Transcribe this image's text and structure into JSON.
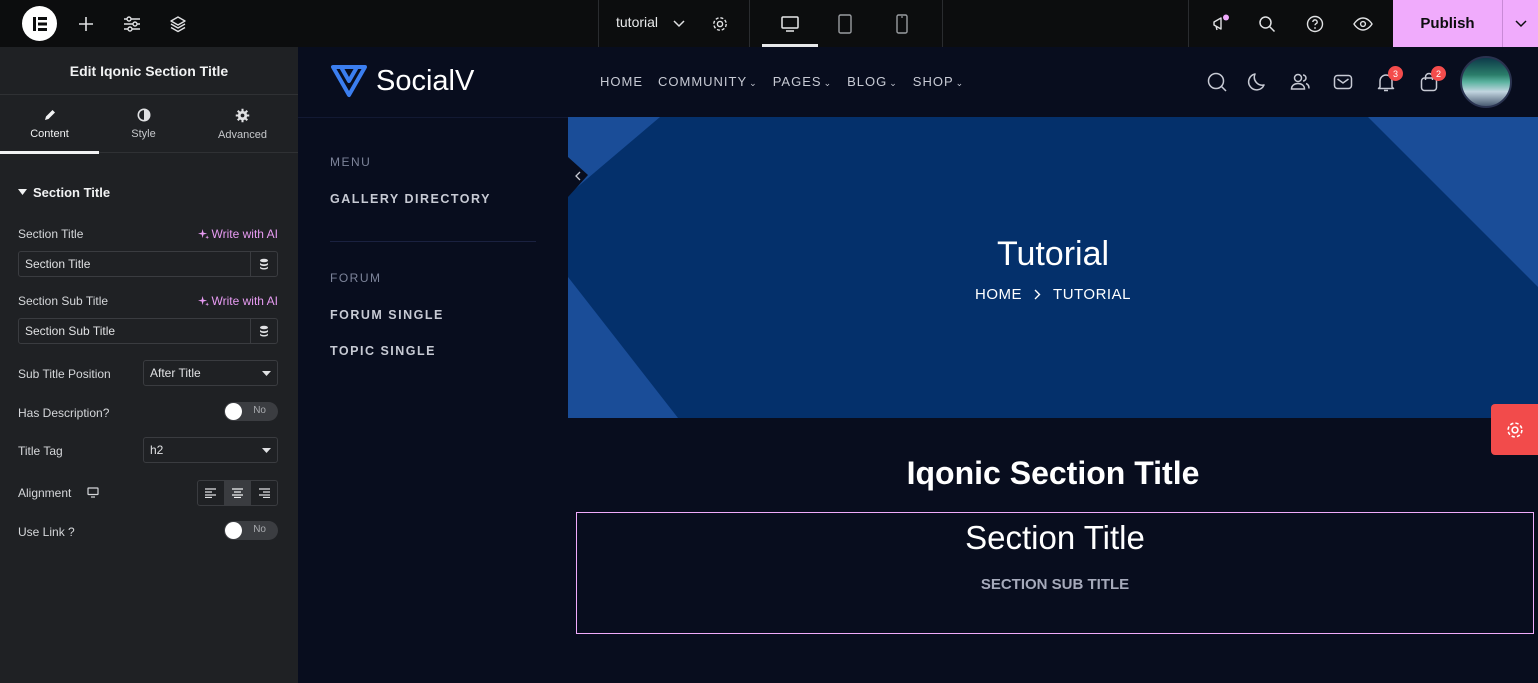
{
  "editor": {
    "page_name": "tutorial",
    "publish_label": "Publish"
  },
  "panel": {
    "title": "Edit Iqonic Section Title",
    "tabs": [
      {
        "label": "Content"
      },
      {
        "label": "Style"
      },
      {
        "label": "Advanced"
      }
    ],
    "section_header": "Section Title",
    "ai_label": "Write with AI",
    "fields": {
      "section_title_label": "Section Title",
      "section_title_value": "Section Title",
      "sub_title_label": "Section Sub Title",
      "sub_title_value": "Section Sub Title",
      "sub_title_position_label": "Sub Title Position",
      "sub_title_position_value": "After Title",
      "has_description_label": "Has Description?",
      "has_description_value": "No",
      "title_tag_label": "Title Tag",
      "title_tag_value": "h2",
      "alignment_label": "Alignment",
      "use_link_label": "Use Link ?",
      "use_link_value": "No"
    }
  },
  "site": {
    "brand": "SocialV",
    "nav": [
      "HOME",
      "COMMUNITY",
      "PAGES",
      "BLOG",
      "SHOP"
    ],
    "notifications_count": "3",
    "cart_count": "2",
    "side_menu": {
      "group1_heading": "MENU",
      "group1_items": [
        "GALLERY DIRECTORY"
      ],
      "group2_heading": "FORUM",
      "group2_items": [
        "FORUM SINGLE",
        "TOPIC SINGLE"
      ]
    },
    "banner": {
      "title": "Tutorial",
      "breadcrumb_home": "HOME",
      "breadcrumb_current": "TUTORIAL"
    },
    "content_title": "Iqonic Section Title",
    "section_title": "Section Title",
    "section_sub_title": "SECTION SUB TITLE"
  },
  "colors": {
    "accent": "#f0abfc",
    "banner": "#04306b",
    "badge": "#f44c4c",
    "panel_bg": "#1f2124"
  }
}
